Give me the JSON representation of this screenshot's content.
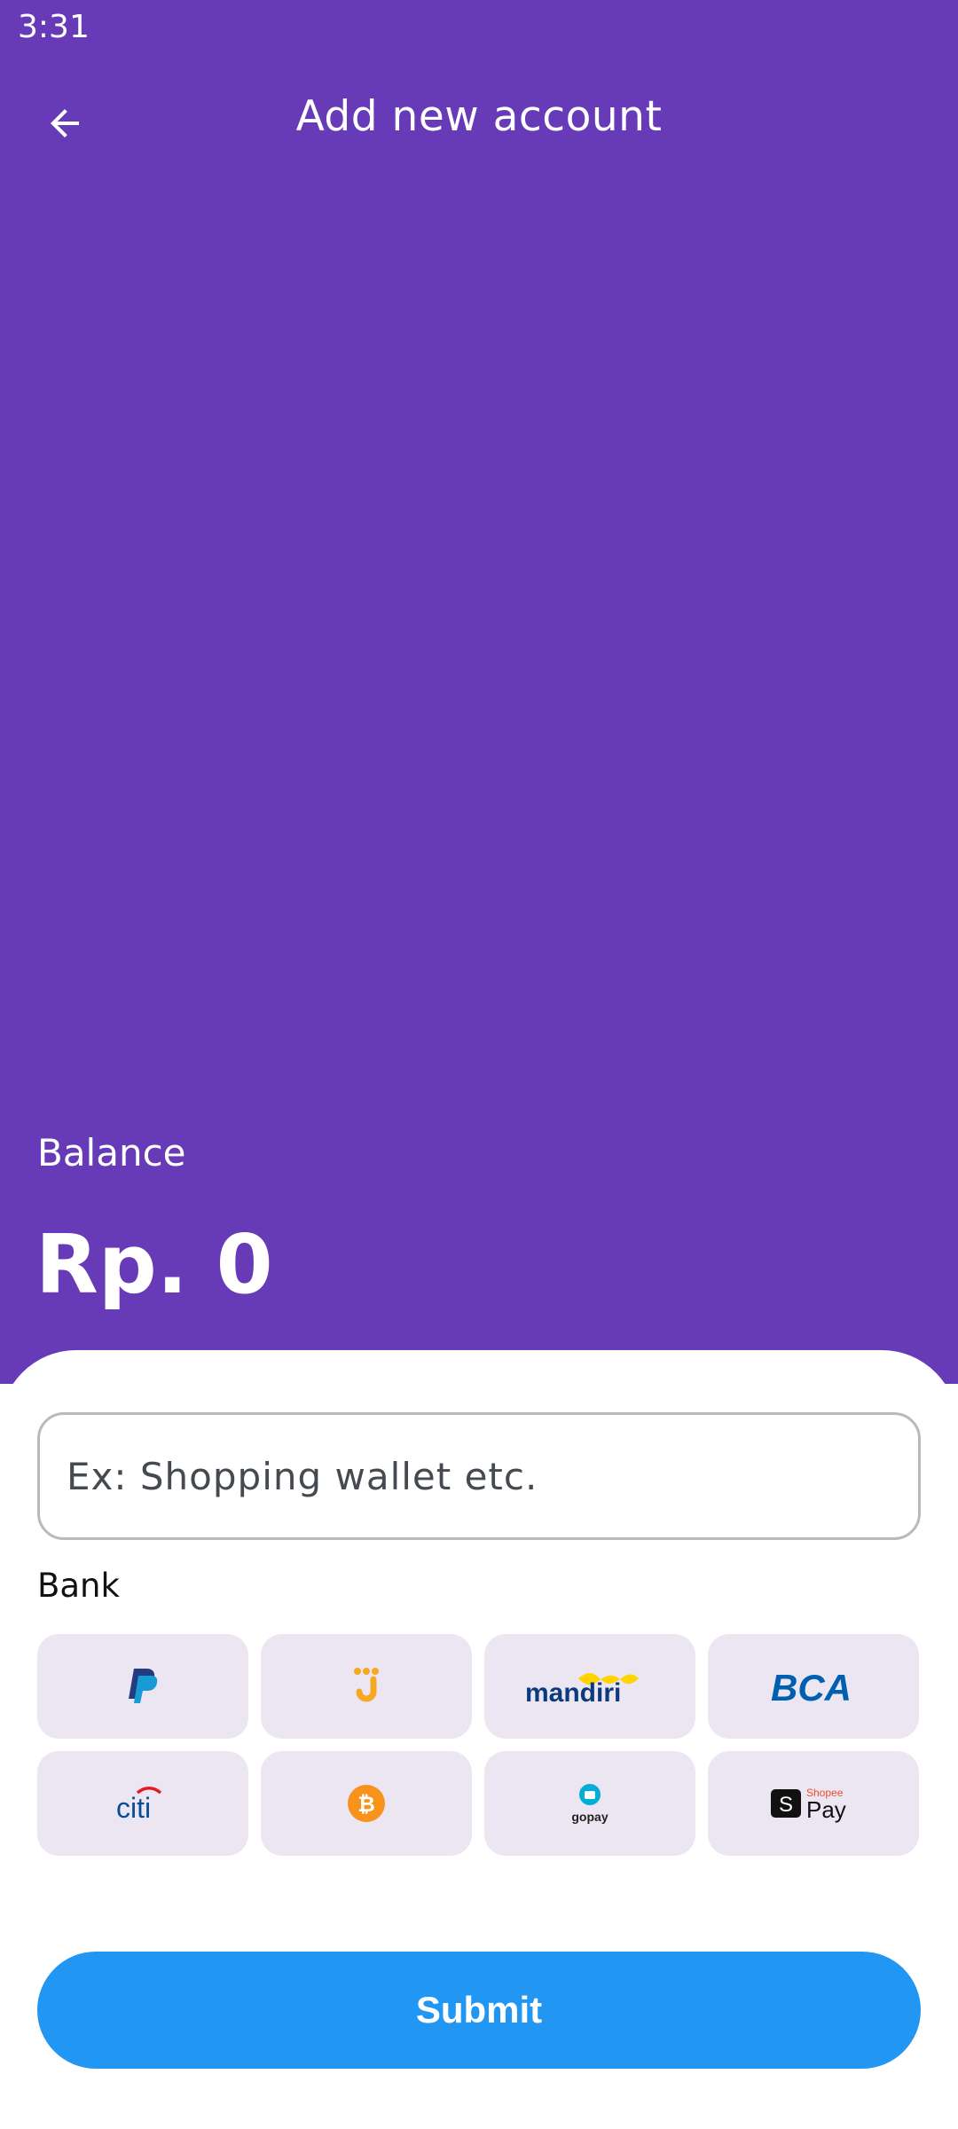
{
  "status_bar": {
    "time": "3:31"
  },
  "header": {
    "title": "Add new account",
    "back_icon": "arrow-left-icon"
  },
  "balance": {
    "label": "Balance",
    "value": "Rp. 0"
  },
  "form": {
    "name_placeholder": "Ex: Shopping wallet etc.",
    "bank_label": "Bank",
    "banks": [
      {
        "name": "PayPal",
        "icon": "paypal-logo"
      },
      {
        "name": "Jenius",
        "icon": "jenius-logo"
      },
      {
        "name": "mandiri",
        "icon": "mandiri-logo"
      },
      {
        "name": "BCA",
        "icon": "bca-logo"
      },
      {
        "name": "citi",
        "icon": "citi-logo"
      },
      {
        "name": "Bitcoin",
        "icon": "bitcoin-logo"
      },
      {
        "name": "gopay",
        "icon": "gopay-logo"
      },
      {
        "name": "Shopee Pay",
        "icon": "shopeepay-logo"
      }
    ],
    "submit_label": "Submit"
  },
  "colors": {
    "primary": "#673AB7",
    "submit": "#2196F3",
    "tile": "#ECE6F3"
  }
}
